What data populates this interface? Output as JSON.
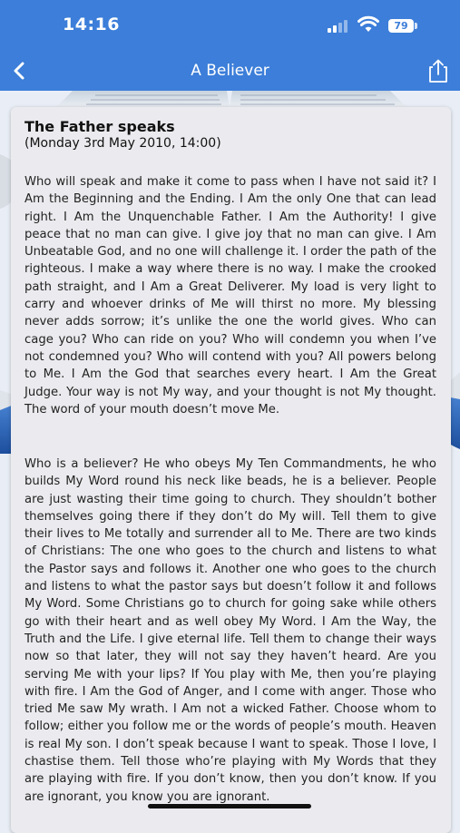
{
  "status_bar": {
    "time": "14:16",
    "battery": "79"
  },
  "nav": {
    "title": "A Believer",
    "back_icon": "chevron-left-icon",
    "share_icon": "share-icon"
  },
  "message": {
    "title": "The Father speaks",
    "date": "(Monday 3rd May 2010, 14:00)",
    "paragraphs": [
      "Who will speak and make it come to pass when I have not said it? I Am the Beginning and the Ending. I Am the only One that can lead right. I Am the Unquenchable Father. I Am the Authority! I give peace that no man can give. I give joy that no man can give. I Am Unbeatable God, and no one will challenge it. I order the path of the righteous. I make a way where there is no way. I make the crooked path straight, and I Am a Great Deliverer. My load is very light to carry and whoever drinks of Me will thirst no more. My blessing never adds sorrow; it’s unlike the one the world gives. Who can cage you? Who can ride on you? Who will condemn you when I’ve not condemned you? Who will contend with you? All powers belong to Me. I Am the God that searches every heart. I Am the Great Judge. Your way is not My way, and your thought is not My thought. The word of your mouth doesn’t move Me.",
      "Who is a believer? He who obeys My Ten Commandments, he who builds My Word round his neck like beads, he is a believer. People are just wasting their time going to church. They shouldn’t bother themselves going there if they don’t do My will. Tell them to give their lives to Me totally and surrender all to Me. There are two kinds of Christians: The one who goes to the church and listens to what the Pastor says and follows it. Another one who goes to the church and listens to what the pastor says but doesn’t follow it and follows My Word. Some Christians go to church for going sake while others go with their heart and as well obey My Word. I Am the Way, the Truth and the Life. I give eternal life. Tell them to change their ways now so that later, they will not say they haven’t heard. Are you serving Me with your lips? If You play with Me, then you’re playing with fire. I Am the God of Anger, and I come with anger. Those who tried Me saw My wrath. I Am not a wicked Father. Choose whom to follow; either you follow me or the words of people’s mouth. Heaven is real My son. I don’t speak because I want to speak. Those I love, I chastise them. Tell those who’re playing with My Words that they are playing with fire. If you don’t know, then you don’t know. If you are ignorant, you know you are ignorant."
    ]
  },
  "colors": {
    "header": "#3c7ed9",
    "card": "#ebebef",
    "text": "#222222"
  }
}
